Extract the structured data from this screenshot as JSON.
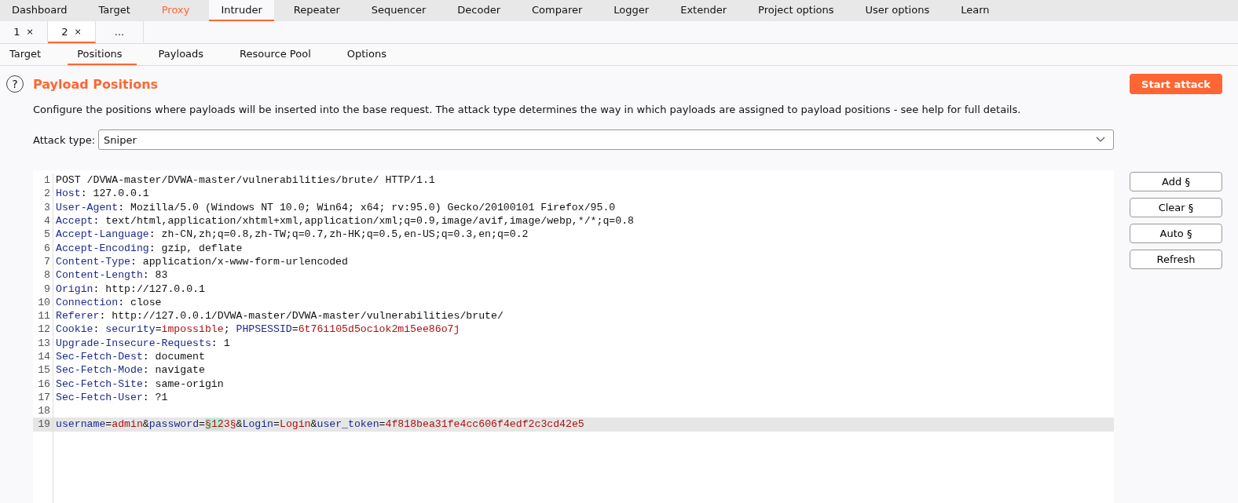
{
  "main_tabs": [
    {
      "label": "Dashboard",
      "selected": false,
      "highlighted": false
    },
    {
      "label": "Target",
      "selected": false,
      "highlighted": false
    },
    {
      "label": "Proxy",
      "selected": false,
      "highlighted": true
    },
    {
      "label": "Intruder",
      "selected": true,
      "highlighted": false
    },
    {
      "label": "Repeater",
      "selected": false,
      "highlighted": false
    },
    {
      "label": "Sequencer",
      "selected": false,
      "highlighted": false
    },
    {
      "label": "Decoder",
      "selected": false,
      "highlighted": false
    },
    {
      "label": "Comparer",
      "selected": false,
      "highlighted": false
    },
    {
      "label": "Logger",
      "selected": false,
      "highlighted": false
    },
    {
      "label": "Extender",
      "selected": false,
      "highlighted": false
    },
    {
      "label": "Project options",
      "selected": false,
      "highlighted": false
    },
    {
      "label": "User options",
      "selected": false,
      "highlighted": false
    },
    {
      "label": "Learn",
      "selected": false,
      "highlighted": false
    }
  ],
  "attack_tabs": [
    {
      "label": "1",
      "close": "×",
      "selected": false
    },
    {
      "label": "2",
      "close": "×",
      "selected": true
    },
    {
      "label": "...",
      "selected": false
    }
  ],
  "sub_tabs": [
    {
      "label": "Target",
      "selected": false
    },
    {
      "label": "Positions",
      "selected": true
    },
    {
      "label": "Payloads",
      "selected": false
    },
    {
      "label": "Resource Pool",
      "selected": false
    },
    {
      "label": "Options",
      "selected": false
    }
  ],
  "section": {
    "help": "?",
    "title": "Payload Positions",
    "description": "Configure the positions where payloads will be inserted into the base request. The attack type determines the way in which payloads are assigned to payload positions - see help for full details.",
    "start_button": "Start attack"
  },
  "attack_type": {
    "label": "Attack type:",
    "value": "Sniper"
  },
  "editor": {
    "lines": [
      {
        "number": "1",
        "current": false,
        "segments": [
          {
            "kind": "plain",
            "text": "POST /DVWA-master/DVWA-master/vulnerabilities/brute/ HTTP/1.1"
          }
        ]
      },
      {
        "number": "2",
        "current": false,
        "segments": [
          {
            "kind": "name",
            "text": "Host"
          },
          {
            "kind": "plain",
            "text": ": 127.0.0.1"
          }
        ]
      },
      {
        "number": "3",
        "current": false,
        "segments": [
          {
            "kind": "name",
            "text": "User-Agent"
          },
          {
            "kind": "plain",
            "text": ": Mozilla/5.0 (Windows NT 10.0; Win64; x64; rv:95.0) Gecko/20100101 Firefox/95.0"
          }
        ]
      },
      {
        "number": "4",
        "current": false,
        "segments": [
          {
            "kind": "name",
            "text": "Accept"
          },
          {
            "kind": "plain",
            "text": ": text/html,application/xhtml+xml,application/xml;q=0.9,image/avif,image/webp,*/*;q=0.8"
          }
        ]
      },
      {
        "number": "5",
        "current": false,
        "segments": [
          {
            "kind": "name",
            "text": "Accept-Language"
          },
          {
            "kind": "plain",
            "text": ": zh-CN,zh;q=0.8,zh-TW;q=0.7,zh-HK;q=0.5,en-US;q=0.3,en;q=0.2"
          }
        ]
      },
      {
        "number": "6",
        "current": false,
        "segments": [
          {
            "kind": "name",
            "text": "Accept-Encoding"
          },
          {
            "kind": "plain",
            "text": ": gzip, deflate"
          }
        ]
      },
      {
        "number": "7",
        "current": false,
        "segments": [
          {
            "kind": "name",
            "text": "Content-Type"
          },
          {
            "kind": "plain",
            "text": ": application/x-www-form-urlencoded"
          }
        ]
      },
      {
        "number": "8",
        "current": false,
        "segments": [
          {
            "kind": "name",
            "text": "Content-Length"
          },
          {
            "kind": "plain",
            "text": ": 83"
          }
        ]
      },
      {
        "number": "9",
        "current": false,
        "segments": [
          {
            "kind": "name",
            "text": "Origin"
          },
          {
            "kind": "plain",
            "text": ": http://127.0.0.1"
          }
        ]
      },
      {
        "number": "10",
        "current": false,
        "segments": [
          {
            "kind": "name",
            "text": "Connection"
          },
          {
            "kind": "plain",
            "text": ": close"
          }
        ]
      },
      {
        "number": "11",
        "current": false,
        "segments": [
          {
            "kind": "name",
            "text": "Referer"
          },
          {
            "kind": "plain",
            "text": ": http://127.0.0.1/DVWA-master/DVWA-master/vulnerabilities/brute/"
          }
        ]
      },
      {
        "number": "12",
        "current": false,
        "segments": [
          {
            "kind": "name",
            "text": "Cookie"
          },
          {
            "kind": "plain",
            "text": ": "
          },
          {
            "kind": "name",
            "text": "security"
          },
          {
            "kind": "plain",
            "text": "="
          },
          {
            "kind": "value",
            "text": "impossible"
          },
          {
            "kind": "plain",
            "text": "; "
          },
          {
            "kind": "name",
            "text": "PHPSESSID"
          },
          {
            "kind": "plain",
            "text": "="
          },
          {
            "kind": "value",
            "text": "6t76i105d5ociok2mi5ee86o7j"
          }
        ]
      },
      {
        "number": "13",
        "current": false,
        "segments": [
          {
            "kind": "name",
            "text": "Upgrade-Insecure-Requests"
          },
          {
            "kind": "plain",
            "text": ": 1"
          }
        ]
      },
      {
        "number": "14",
        "current": false,
        "segments": [
          {
            "kind": "name",
            "text": "Sec-Fetch-Dest"
          },
          {
            "kind": "plain",
            "text": ": document"
          }
        ]
      },
      {
        "number": "15",
        "current": false,
        "segments": [
          {
            "kind": "name",
            "text": "Sec-Fetch-Mode"
          },
          {
            "kind": "plain",
            "text": ": navigate"
          }
        ]
      },
      {
        "number": "16",
        "current": false,
        "segments": [
          {
            "kind": "name",
            "text": "Sec-Fetch-Site"
          },
          {
            "kind": "plain",
            "text": ": same-origin"
          }
        ]
      },
      {
        "number": "17",
        "current": false,
        "segments": [
          {
            "kind": "name",
            "text": "Sec-Fetch-User"
          },
          {
            "kind": "plain",
            "text": ": ?1"
          }
        ]
      },
      {
        "number": "18",
        "current": false
      },
      {
        "number": "19",
        "current": true,
        "segments": [
          {
            "kind": "name",
            "text": "username"
          },
          {
            "kind": "plain",
            "text": "="
          },
          {
            "kind": "value",
            "text": "admin"
          },
          {
            "kind": "plain",
            "text": "&"
          },
          {
            "kind": "name",
            "text": "password"
          },
          {
            "kind": "plain",
            "text": "="
          },
          {
            "kind": "payload",
            "text": "§12"
          },
          {
            "kind": "value",
            "text": "3§"
          },
          {
            "kind": "plain",
            "text": "&"
          },
          {
            "kind": "name",
            "text": "Login"
          },
          {
            "kind": "plain",
            "text": "="
          },
          {
            "kind": "value",
            "text": "Login"
          },
          {
            "kind": "plain",
            "text": "&"
          },
          {
            "kind": "name",
            "text": "user_token"
          },
          {
            "kind": "plain",
            "text": "="
          },
          {
            "kind": "value",
            "text": "4f818bea31fe4cc606f4edf2c3cd42e5"
          }
        ]
      }
    ]
  },
  "side_buttons": [
    "Add §",
    "Clear §",
    "Auto §",
    "Refresh"
  ]
}
